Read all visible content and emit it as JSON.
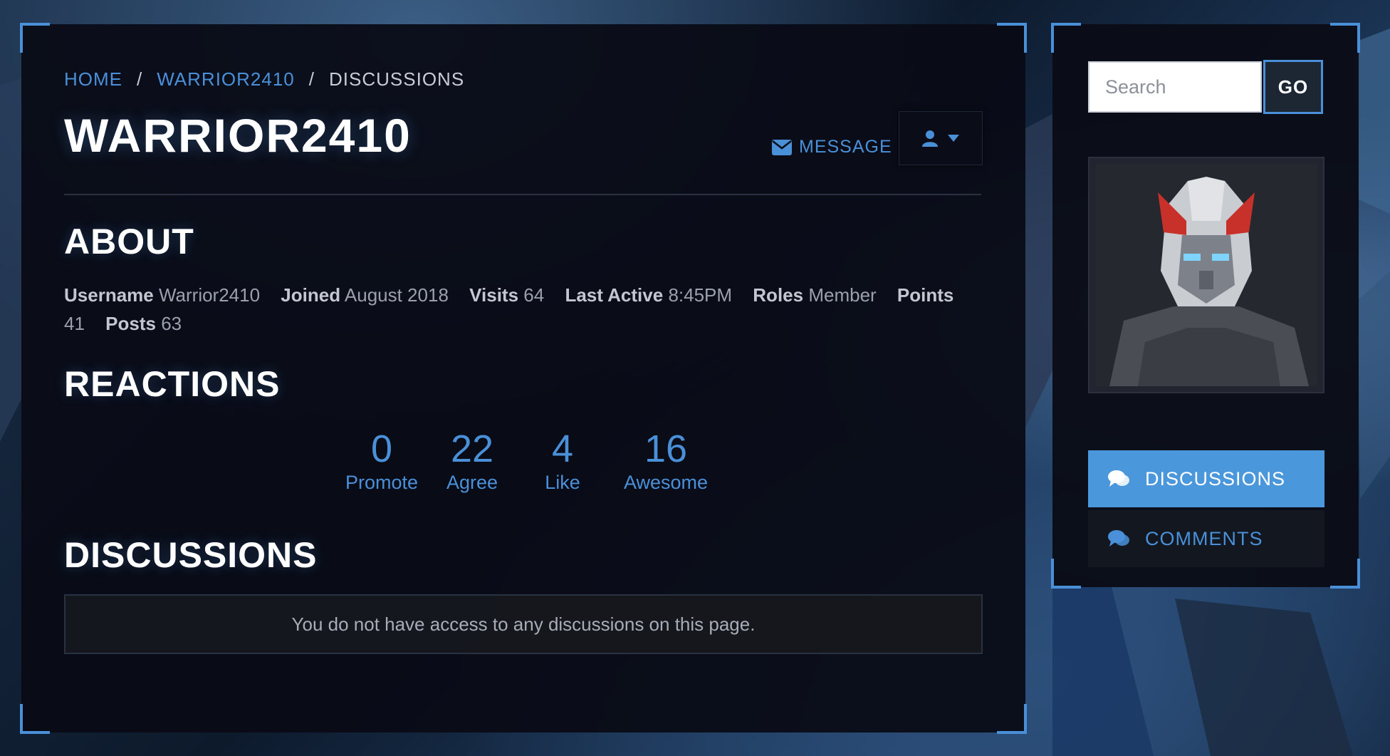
{
  "breadcrumb": {
    "home": "HOME",
    "user": "WARRIOR2410",
    "current": "DISCUSSIONS",
    "separator": "/"
  },
  "profile": {
    "title": "WARRIOR2410",
    "message_label": "MESSAGE"
  },
  "about": {
    "heading": "ABOUT",
    "fields": [
      {
        "label": "Username",
        "value": "Warrior2410"
      },
      {
        "label": "Joined",
        "value": "August 2018"
      },
      {
        "label": "Visits",
        "value": "64"
      },
      {
        "label": "Last Active",
        "value": "8:45PM"
      },
      {
        "label": "Roles",
        "value": "Member"
      },
      {
        "label": "Points",
        "value": "41"
      },
      {
        "label": "Posts",
        "value": "63"
      }
    ]
  },
  "reactions": {
    "heading": "REACTIONS",
    "items": [
      {
        "count": "0",
        "name": "Promote"
      },
      {
        "count": "22",
        "name": "Agree"
      },
      {
        "count": "4",
        "name": "Like"
      },
      {
        "count": "16",
        "name": "Awesome"
      }
    ]
  },
  "discussions": {
    "heading": "DISCUSSIONS",
    "empty_message": "You do not have access to any discussions on this page."
  },
  "sidebar": {
    "search_placeholder": "Search",
    "search_value": "",
    "go_label": "GO",
    "nav": [
      {
        "label": "DISCUSSIONS",
        "icon": "comments-icon",
        "active": true
      },
      {
        "label": "COMMENTS",
        "icon": "comments-icon",
        "active": false
      }
    ]
  },
  "colors": {
    "accent": "#4a90d9",
    "active_nav_bg": "#4a97dc",
    "panel_bg": "#0a0c16",
    "heading_text": "#ffffff"
  }
}
